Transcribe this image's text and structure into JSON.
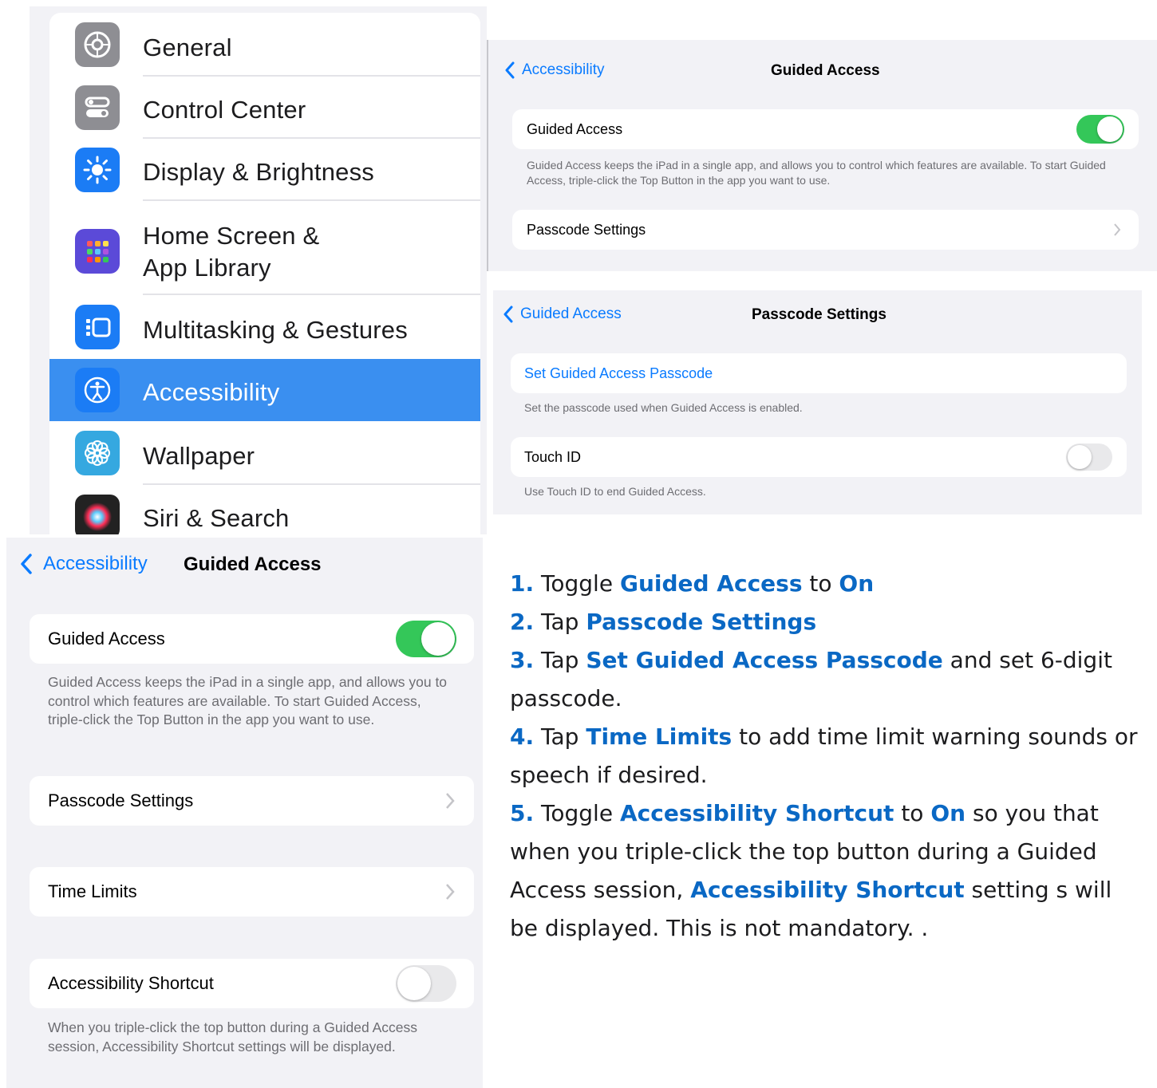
{
  "sidebar": {
    "items": [
      {
        "label": "General",
        "icon": "gear-icon",
        "color": "#8e8e93"
      },
      {
        "label": "Control Center",
        "icon": "toggles-icon",
        "color": "#8e8e93"
      },
      {
        "label": "Display & Brightness",
        "icon": "sun-icon",
        "color": "#1b7cf5"
      },
      {
        "label_line1": "Home Screen &",
        "label_line2": "App Library",
        "icon": "app-grid-icon",
        "color": "#5b4ad8"
      },
      {
        "label": "Multitasking & Gestures",
        "icon": "multitasking-icon",
        "color": "#1b7cf5"
      },
      {
        "label": "Accessibility",
        "icon": "accessibility-icon",
        "color": "#1b7cf5",
        "selected": true
      },
      {
        "label": "Wallpaper",
        "icon": "flower-icon",
        "color": "#35a8e0"
      },
      {
        "label": "Siri & Search",
        "icon": "siri-icon",
        "color": "#222222"
      }
    ],
    "selected_color": "#3a8ff0"
  },
  "ga_top": {
    "back": "Accessibility",
    "title": "Guided Access",
    "toggle_label": "Guided Access",
    "toggle_on": true,
    "description": "Guided Access keeps the iPad in a single app, and allows you to control which features are available. To start Guided Access, triple-click the Top Button in the app you want to use.",
    "passcode_label": "Passcode Settings"
  },
  "passcode": {
    "back": "Guided Access",
    "title": "Passcode Settings",
    "set_passcode": "Set Guided Access Passcode",
    "set_note": "Set the passcode used when Guided Access is enabled.",
    "touch_id_label": "Touch ID",
    "touch_id_on": false,
    "touch_id_note": "Use Touch ID to end Guided Access."
  },
  "ga_big": {
    "back": "Accessibility",
    "title": "Guided Access",
    "toggle_label": "Guided Access",
    "toggle_on": true,
    "description": "Guided Access keeps the iPad in a single app, and allows you to control which features are available. To start Guided Access, triple-click the Top Button in the app you want to use.",
    "passcode_label": "Passcode Settings",
    "time_limits_label": "Time Limits",
    "shortcut_label": "Accessibility Shortcut",
    "shortcut_on": false,
    "shortcut_note": "When you triple-click the top button during a Guided Access session, Accessibility Shortcut settings will be displayed."
  },
  "colors": {
    "toggle_on": "#34c759",
    "toggle_off": "#e9e9eb",
    "ios_blue": "#0a7bff",
    "instruction_blue": "#0a68c4"
  },
  "instructions": {
    "s1": {
      "num": "1.",
      "a": "Toggle ",
      "b": "Guided Access",
      "c": " to ",
      "d": "On"
    },
    "s2": {
      "num": "2.",
      "a": "Tap ",
      "b": "Passcode Settings"
    },
    "s3": {
      "num": "3.",
      "a": "Tap ",
      "b": "Set Guided Access Passcode",
      "c": " and set 6-digit passcode."
    },
    "s4": {
      "num": "4.",
      "a": "Tap ",
      "b": "Time Limits",
      "c": " to add time limit warning sounds or speech if desired."
    },
    "s5": {
      "num": "5.",
      "a": "Toggle ",
      "b": "Accessibility Shortcut",
      "c": " to ",
      "d": "On",
      "e": " so you that when you triple-click the top button during a Guided Access session, ",
      "f": "Accessibility Shortcut",
      "g": " setting s will be displayed. This is not mandatory. ."
    }
  }
}
